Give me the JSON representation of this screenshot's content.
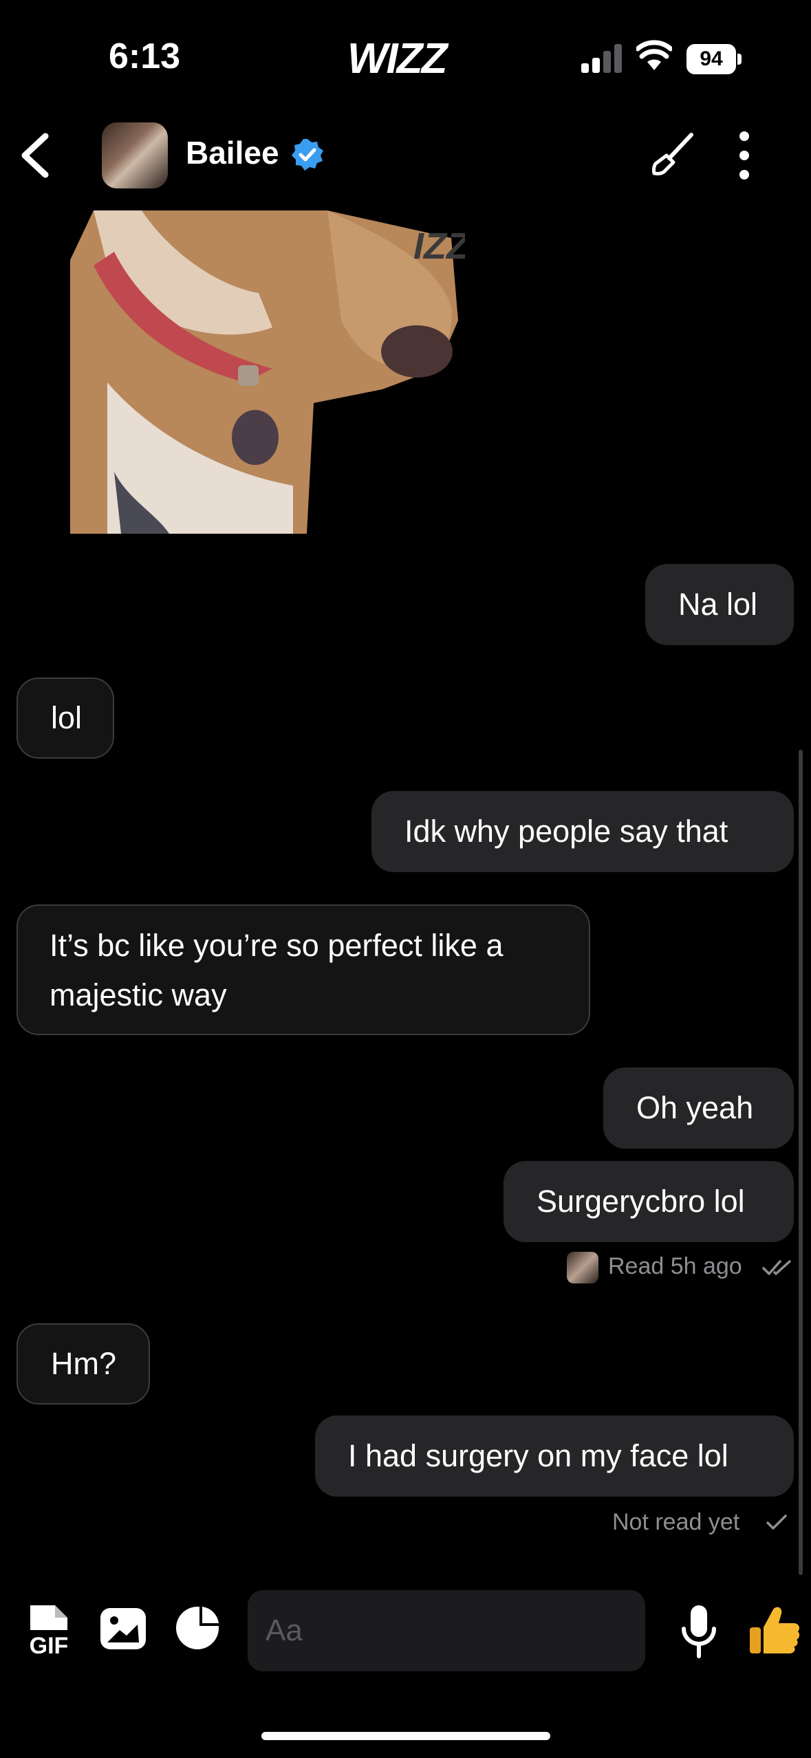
{
  "status_bar": {
    "time": "6:13",
    "brand": "WIZZ",
    "battery": "94"
  },
  "header": {
    "contact_name": "Bailee",
    "verified_color": "#3a9df0"
  },
  "messages": [
    {
      "text": "Na lol",
      "direction": "outgoing"
    },
    {
      "text": "lol",
      "direction": "incoming"
    },
    {
      "text": "Idk why people say that",
      "direction": "outgoing"
    },
    {
      "text": "It’s bc like you’re so perfect like a majestic way",
      "direction": "incoming"
    },
    {
      "text": "Oh yeah",
      "direction": "outgoing"
    },
    {
      "text": "Surgerycbro lol",
      "direction": "outgoing"
    },
    {
      "text": "Hm?",
      "direction": "incoming"
    },
    {
      "text": "I had surgery on my face lol",
      "direction": "outgoing"
    }
  ],
  "receipts": {
    "read": "Read 5h ago",
    "not_read": "Not read yet"
  },
  "sticker": {
    "watermark": "IZZ"
  },
  "composer": {
    "placeholder": "Aa",
    "gif_label": "GIF",
    "thumbs_color": "#f5b82e"
  }
}
